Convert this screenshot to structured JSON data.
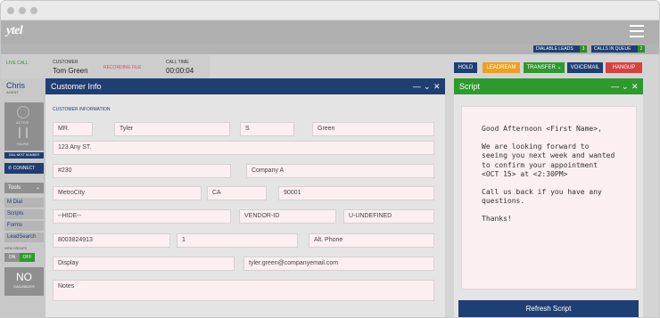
{
  "brand": {
    "logo": "ytel"
  },
  "leads": {
    "dialable_label": "DIALABLE LEADS",
    "dialable_count": "3",
    "queue_label": "CALLS IN QUEUE",
    "queue_count": "2"
  },
  "call": {
    "status": "LIVE CALL",
    "customer_label": "CUSTOMER",
    "customer_name": "Tom Green",
    "recording": "RECORDING FILE",
    "time_label": "CALL TIME",
    "time_value": "00:00:04"
  },
  "actions": {
    "hold": "HOLD",
    "leadream": "LEADREAM",
    "transfer": "TRANSFER",
    "voicemail": "VOICEMAIL",
    "hangup": "HANGUP"
  },
  "agent": {
    "name": "Chris",
    "role": "AGENT",
    "active": "ACTIVE",
    "pause": "PAUSE",
    "dial_next": "DIAL NEXT NUMBER",
    "connect": "CONNECT"
  },
  "tools": {
    "label": "Tools",
    "links": [
      "M Dial",
      "Scripts",
      "Forms",
      "LeadSearch"
    ],
    "toggle_caption": "VIEW GROUPS",
    "on": "ON",
    "off": "OFF",
    "no_big": "NO",
    "no_small": "CALLBACKS"
  },
  "customer_panel": {
    "title": "Customer Info",
    "section": "CUSTOMER INFORMATION",
    "fields": {
      "salutation": "MR.",
      "first_name": "Tyler",
      "middle": "S",
      "last_name": "Green",
      "address1": "123 Any ST.",
      "address2": "#230",
      "company": "Company A",
      "city": "MetroCity",
      "state": "CA",
      "zip": "90001",
      "hide": "--HIDE--",
      "vendor": "VENDOR-ID",
      "undefined": "U-UNDEFINED",
      "phone": "8003824913",
      "code": "1",
      "alt_phone": "Alt. Phone",
      "display": "Display",
      "email": "tyler.green@companyemail.com",
      "notes": "Notes"
    }
  },
  "script_panel": {
    "title": "Script",
    "lines": [
      "Good Afternoon <First Name>,",
      "We are looking forward to seeing you next week and wanted to confirm your appointment <OCT 15> at <2:30PM>",
      "Call us back if you have any questions.",
      "Thanks!"
    ],
    "refresh": "Refresh Script"
  },
  "colors": {
    "navy": "#1f3f73",
    "green": "#2e9a2e",
    "orange": "#f0a020",
    "red": "#d94040",
    "recording": "#e05050",
    "live": "#2e9a2e"
  }
}
